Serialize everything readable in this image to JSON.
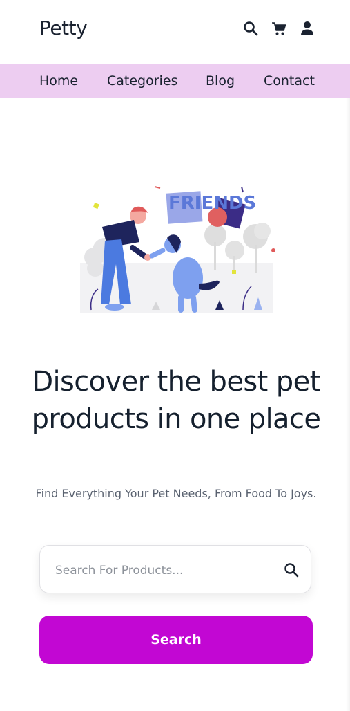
{
  "header": {
    "logo": "Petty",
    "icons": [
      "search-icon",
      "cart-icon",
      "user-icon"
    ]
  },
  "nav": {
    "items": [
      {
        "label": "Home"
      },
      {
        "label": "Categories"
      },
      {
        "label": "Blog"
      },
      {
        "label": "Contact"
      }
    ]
  },
  "hero": {
    "illustration_text": "FRIENDS",
    "headline": "Discover the best pet products in one place",
    "subtitle": "Find Everything Your Pet Needs, From Food To Joys."
  },
  "search": {
    "placeholder": "Search For Products...",
    "value": "",
    "button_label": "Search"
  },
  "colors": {
    "accent": "#c207d3",
    "nav_background": "#edcdf1",
    "text_dark": "#15202e",
    "text_muted": "#5a6270"
  }
}
